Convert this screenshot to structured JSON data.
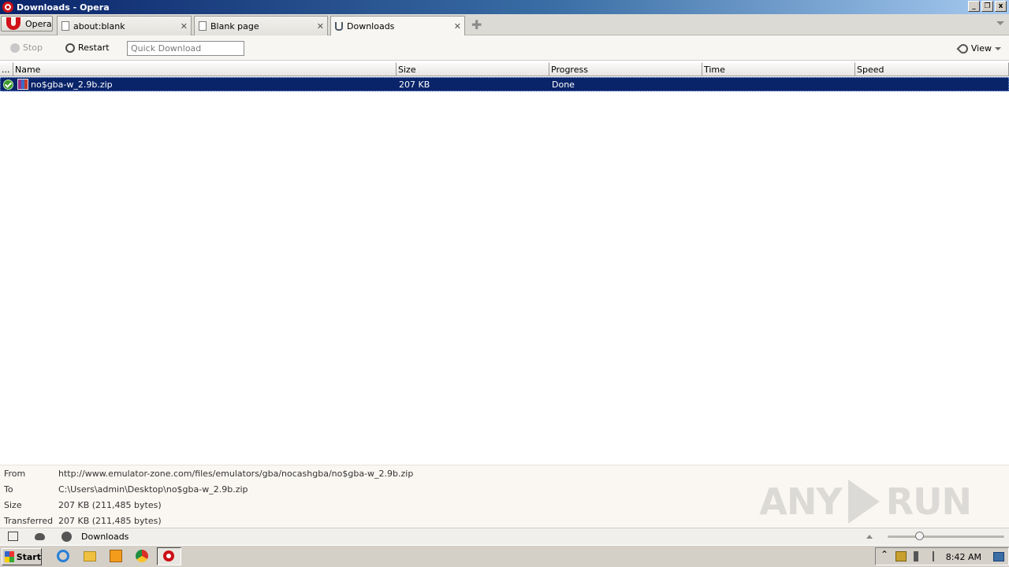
{
  "window": {
    "title": "Downloads - Opera"
  },
  "tabs": {
    "opera_menu_label": "Opera",
    "items": [
      {
        "label": "about:blank"
      },
      {
        "label": "Blank page"
      },
      {
        "label": "Downloads"
      }
    ],
    "close_glyph": "✕",
    "new_tab_glyph": "✚"
  },
  "toolbar": {
    "stop_label": "Stop",
    "restart_label": "Restart",
    "quick_download_placeholder": "Quick Download",
    "view_label": "View"
  },
  "downloads": {
    "columns": [
      "...",
      "Name",
      "Size",
      "Progress",
      "Time",
      "Speed"
    ],
    "rows": [
      {
        "name": "no$gba-w_2.9b.zip",
        "size": "207 KB",
        "progress": "Done",
        "time": "",
        "speed": ""
      }
    ]
  },
  "details": {
    "from_label": "From",
    "from_value": "http://www.emulator-zone.com/files/emulators/gba/nocashgba/no$gba-w_2.9b.zip",
    "to_label": "To",
    "to_value": "C:\\Users\\admin\\Desktop\\no$gba-w_2.9b.zip",
    "size_label": "Size",
    "size_value": "207 KB (211,485 bytes)",
    "transferred_label": "Transferred",
    "transferred_value": "207 KB (211,485 bytes)"
  },
  "watermark": {
    "left": "ANY",
    "right": "RUN"
  },
  "statusbar": {
    "label": "Downloads"
  },
  "taskbar": {
    "start_label": "Start",
    "clock": "8:42 AM"
  },
  "colors": {
    "selection": "#0a246a",
    "titlebar": "#0a246a",
    "opera_red": "#cc0f16"
  },
  "icons": [
    "opera-icon",
    "page-icon",
    "downloads-icon",
    "stop-icon",
    "restart-icon",
    "wrench-icon",
    "check-icon",
    "zip-icon",
    "panel-icon",
    "cloud-icon",
    "speed-dial-icon",
    "ie-icon",
    "folder-icon",
    "media-player-icon",
    "chrome-icon"
  ]
}
